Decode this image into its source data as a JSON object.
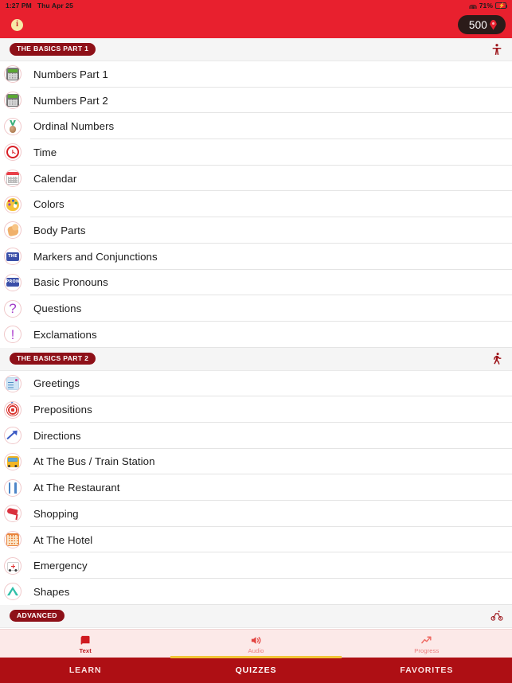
{
  "status_bar": {
    "time": "1:27 PM",
    "date": "Thu Apr 25",
    "wifi_icon": "wifi-icon",
    "battery_percent": "71%",
    "battery_icon": "battery-charging-icon"
  },
  "app_bar": {
    "info_icon": "info-icon",
    "info_label": "i",
    "points": "500",
    "points_icon": "location-pin-icon"
  },
  "sections": [
    {
      "badge": "THE BASICS PART 1",
      "level_icon": "standing-person-icon",
      "items": [
        {
          "label": "Numbers Part 1",
          "icon": "calculator-icon"
        },
        {
          "label": "Numbers Part 2",
          "icon": "calculator-icon"
        },
        {
          "label": "Ordinal Numbers",
          "icon": "medal-icon"
        },
        {
          "label": "Time",
          "icon": "alarm-clock-icon"
        },
        {
          "label": "Calendar",
          "icon": "calendar-icon"
        },
        {
          "label": "Colors",
          "icon": "artist-palette-icon"
        },
        {
          "label": "Body Parts",
          "icon": "flexed-biceps-icon"
        },
        {
          "label": "Markers and Conjunctions",
          "icon": "the-badge-icon",
          "badge_text": "THE"
        },
        {
          "label": "Basic Pronouns",
          "icon": "pron-badge-icon",
          "badge_text": "PRON"
        },
        {
          "label": "Questions",
          "icon": "question-mark-icon",
          "glyph": "?"
        },
        {
          "label": "Exclamations",
          "icon": "exclamation-mark-icon",
          "glyph": "!"
        }
      ]
    },
    {
      "badge": "THE BASICS PART 2",
      "level_icon": "walking-person-icon",
      "items": [
        {
          "label": "Greetings",
          "icon": "greeting-card-icon"
        },
        {
          "label": "Prepositions",
          "icon": "dart-board-icon"
        },
        {
          "label": "Directions",
          "icon": "up-right-arrow-icon"
        },
        {
          "label": "At The Bus / Train Station",
          "icon": "bus-icon"
        },
        {
          "label": "At The Restaurant",
          "icon": "fork-and-knife-icon"
        },
        {
          "label": "Shopping",
          "icon": "high-heel-icon"
        },
        {
          "label": "At The Hotel",
          "icon": "hotel-icon"
        },
        {
          "label": "Emergency",
          "icon": "ambulance-icon"
        },
        {
          "label": "Shapes",
          "icon": "triangle-icon"
        }
      ]
    },
    {
      "badge": "ADVANCED",
      "level_icon": "bicycle-icon",
      "items": []
    }
  ],
  "mode_bar": {
    "modes": [
      {
        "label": "Text",
        "icon": "book-icon",
        "state": "active"
      },
      {
        "label": "Audio",
        "icon": "speaker-icon",
        "state": "dim"
      },
      {
        "label": "Progress",
        "icon": "trend-up-icon",
        "state": "dim"
      }
    ]
  },
  "tab_bar": {
    "tabs": [
      {
        "label": "LEARN",
        "active": false
      },
      {
        "label": "QUIZZES",
        "active": true
      },
      {
        "label": "FAVORITES",
        "active": false
      }
    ]
  },
  "colors": {
    "header_red": "#E8202E",
    "badge_dark_red": "#8E1018",
    "tabbar_red": "#AE0F14",
    "accent_yellow": "#F2C438",
    "modebar_pink": "#FCE9E8",
    "section_bg": "#F5F5F5"
  }
}
